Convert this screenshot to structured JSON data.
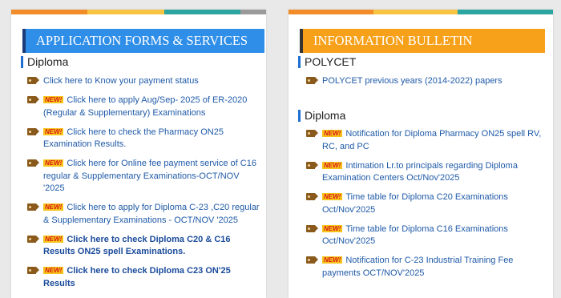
{
  "left": {
    "banner": "APPLICATION FORMS & SERVICES",
    "section": "Diploma",
    "items": [
      {
        "new": false,
        "text": "Click here to Know your payment status"
      },
      {
        "new": true,
        "text": "Click here to apply Aug/Sep- 2025 of ER-2020 (Regular & Supplementary) Examinations"
      },
      {
        "new": true,
        "text": "Click here to check the Pharmacy ON25 Examination Results."
      },
      {
        "new": true,
        "text": "Click here for Online fee payment service of C16 regular & Supplementary Examinations-OCT/NOV '2025"
      },
      {
        "new": true,
        "text": "Click here to apply for Diploma C-23 ,C20 regular & Supplementary Examinations - OCT/NOV '2025"
      },
      {
        "new": true,
        "text": "Click here to check Diploma C20 & C16 Results ON25 spell Examinations."
      },
      {
        "new": true,
        "text": "Click here to check Diploma C23 ON'25 Results"
      }
    ]
  },
  "right": {
    "banner": "INFORMATION BULLETIN",
    "section1": "POLYCET",
    "polycet_items": [
      {
        "new": false,
        "text": "POLYCET previous years (2014-2022) papers"
      }
    ],
    "section2": "Diploma",
    "items": [
      {
        "new": true,
        "text": "Notification for Diploma Pharmacy ON25 spell RV, RC, and PC"
      },
      {
        "new": true,
        "text": "Intimation Lr.to principals regarding Diploma Examination Centers Oct/Nov'2025"
      },
      {
        "new": true,
        "text": "Time table for Diploma C20 Examinations Oct/Nov'2025"
      },
      {
        "new": true,
        "text": "Time table for Diploma C16 Examinations Oct/Nov'2025"
      },
      {
        "new": true,
        "text": "Notification for C-23 Industrial Training Fee payments OCT/NOV'2025"
      }
    ]
  },
  "new_label": "NEW!",
  "colors": {
    "blue_banner": "#2f8ee8",
    "orange_banner": "#f7a11a",
    "link": "#1f5aa8",
    "new_badge": "#f7c21b"
  }
}
